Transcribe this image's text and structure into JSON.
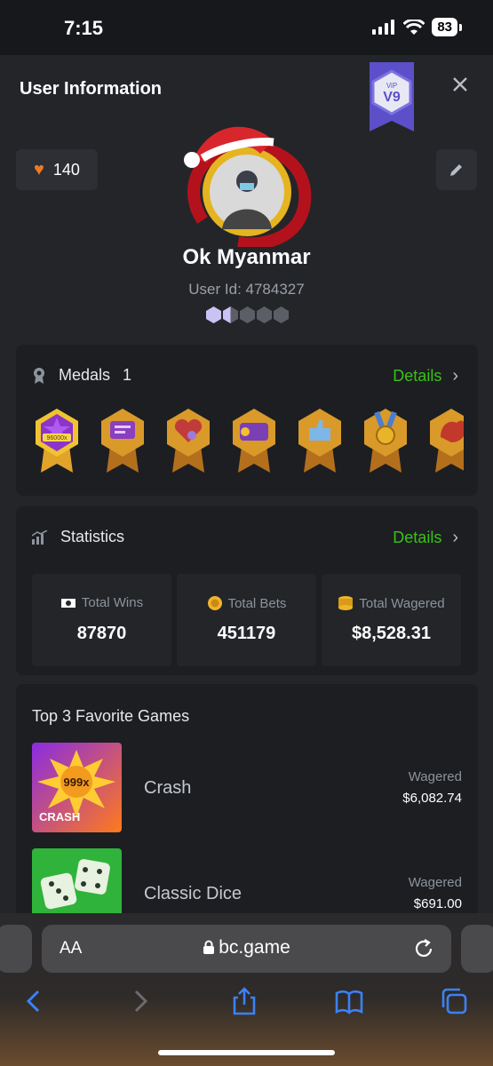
{
  "status_bar": {
    "time": "7:15",
    "battery": "83"
  },
  "header": {
    "title": "User Information",
    "vip_label": "V9",
    "vip_small": "ViP"
  },
  "profile": {
    "likes": "140",
    "username": "Ok Myanmar",
    "user_id": "User Id: 4784327"
  },
  "medals": {
    "label": "Medals",
    "count": "1",
    "details": "Details",
    "badge_text": "96000x"
  },
  "statistics": {
    "label": "Statistics",
    "details": "Details",
    "items": [
      {
        "label": "Total Wins",
        "value": "87870",
        "icon": "trophy-ticket-icon"
      },
      {
        "label": "Total Bets",
        "value": "451179",
        "icon": "coin-icon"
      },
      {
        "label": "Total Wagered",
        "value": "$8,528.31",
        "icon": "coin-stack-icon"
      }
    ]
  },
  "favorites": {
    "title": "Top 3 Favorite Games",
    "games": [
      {
        "name": "Crash",
        "wager_label": "Wagered",
        "wager_value": "$6,082.74",
        "thumb_text": "CRASH",
        "thumb_mult": "999x"
      },
      {
        "name": "Classic Dice",
        "wager_label": "Wagered",
        "wager_value": "$691.00"
      }
    ]
  },
  "browser": {
    "url": "bc.game",
    "aa_label": "AA"
  },
  "colors": {
    "accent_green": "#3bc117",
    "heart_orange": "#ee7a1f",
    "vip_purple": "#6a5fd6"
  }
}
